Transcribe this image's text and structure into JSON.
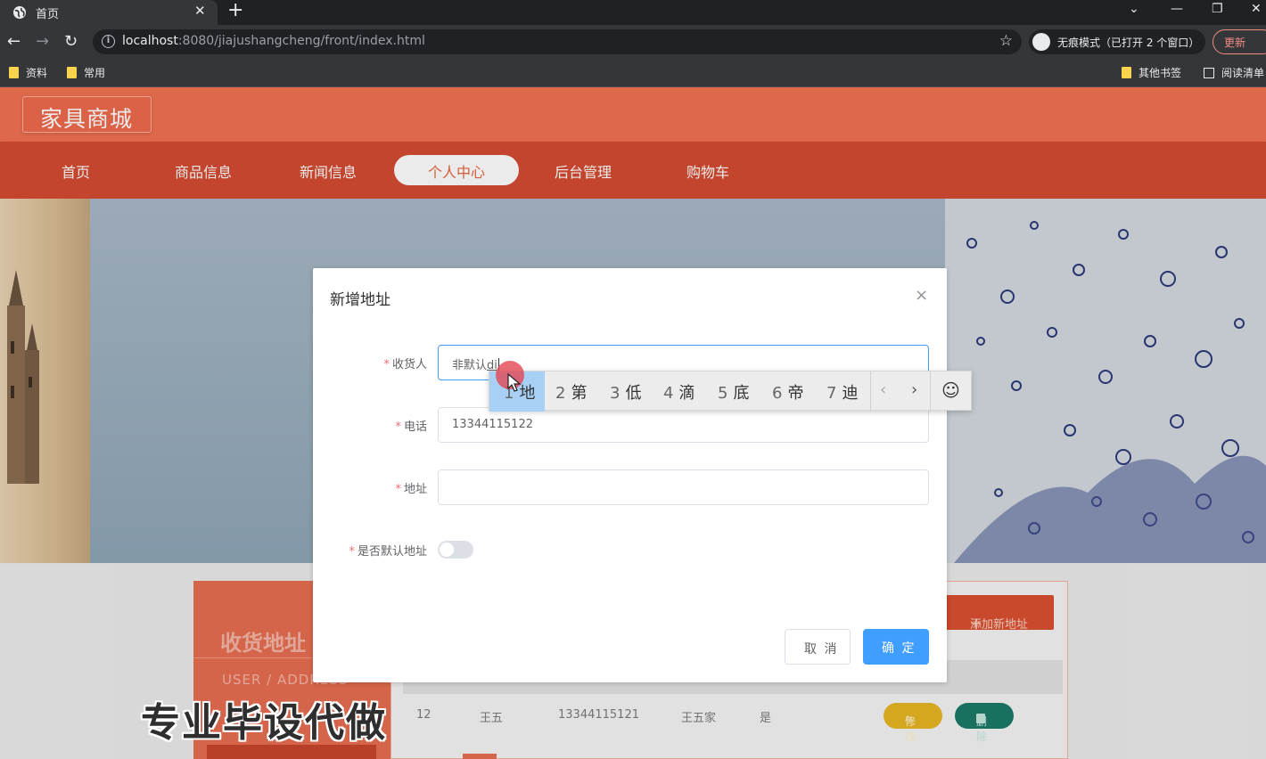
{
  "browser": {
    "tab_title": "首页",
    "tab_close": "✕",
    "new_tab": "+",
    "window_controls": [
      "⌄",
      "—",
      "❐",
      "✕"
    ],
    "url_host": "localhost",
    "url_rest": ":8080/jiajushangcheng/front/index.html",
    "incognito_text": "无痕模式（已打开 2 个窗口）",
    "update_label": "更新",
    "bookmarks": [
      "资料",
      "常用"
    ],
    "bookmarks_right": [
      "其他书签",
      "阅读清单"
    ]
  },
  "site": {
    "logo": "家具商城",
    "nav": [
      "首页",
      "商品信息",
      "新闻信息",
      "个人中心",
      "后台管理",
      "购物车"
    ],
    "active_nav": "个人中心"
  },
  "page": {
    "side_title": "收货地址",
    "side_subtitle": "USER / ADDRESS",
    "add_button": "添加新地址",
    "row": {
      "id": "12",
      "name": "王五",
      "phone": "13344115121",
      "address": "王五家",
      "is_default": "是",
      "edit_label": "修改",
      "delete_label": "删除"
    },
    "watermark": "专业毕设代做"
  },
  "dialog": {
    "title": "新增地址",
    "close": "×",
    "fields": {
      "receiver": {
        "label": "收货人",
        "value": "非默认",
        "composing": "di"
      },
      "phone": {
        "label": "电话",
        "value": "13344115122"
      },
      "address": {
        "label": "地址",
        "value": ""
      },
      "default": {
        "label": "是否默认地址",
        "on": false
      }
    },
    "cancel_label": "取 消",
    "ok_label": "确 定"
  },
  "ime": {
    "candidates": [
      {
        "num": "1",
        "text": "地"
      },
      {
        "num": "2",
        "text": "第"
      },
      {
        "num": "3",
        "text": "低"
      },
      {
        "num": "4",
        "text": "滴"
      },
      {
        "num": "5",
        "text": "底"
      },
      {
        "num": "6",
        "text": "帝"
      },
      {
        "num": "7",
        "text": "迪"
      }
    ],
    "prev": "‹",
    "next": "›",
    "emoji": "☺"
  },
  "colors": {
    "header": "#f07151",
    "nav": "#d44b31",
    "primary": "#409eff",
    "required": "#f56c6c"
  }
}
